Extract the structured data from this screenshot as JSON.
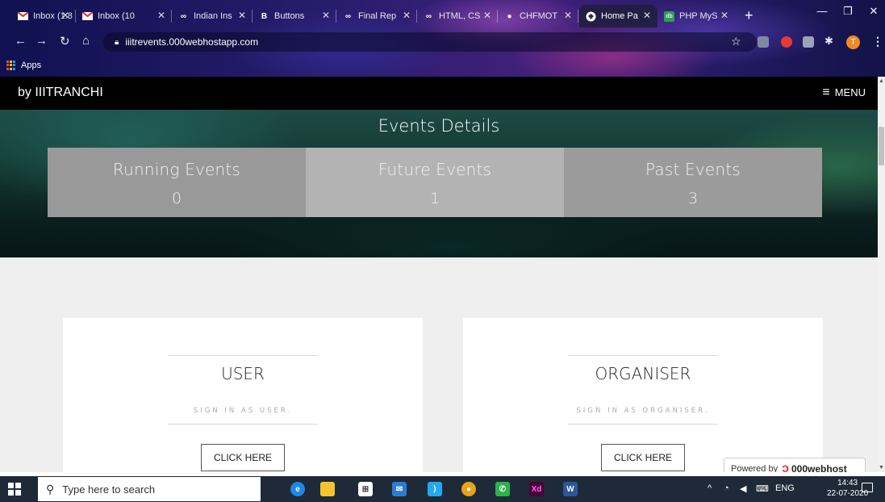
{
  "browser": {
    "tabs": [
      {
        "title": "Inbox (1.8",
        "icon": "gmail-icon",
        "active": false
      },
      {
        "title": "Inbox (10",
        "icon": "gmail-icon",
        "active": false
      },
      {
        "title": "Indian Ins",
        "icon": "infinity-icon",
        "active": false
      },
      {
        "title": "Buttons",
        "icon": "bootstrap-icon",
        "active": false
      },
      {
        "title": "Final Rep",
        "icon": "infinity-icon",
        "active": false
      },
      {
        "title": "HTML, CS",
        "icon": "infinity-icon",
        "active": false
      },
      {
        "title": "CHFMOT",
        "icon": "tab-icon",
        "active": false
      },
      {
        "title": "Home Pa",
        "icon": "globe-icon",
        "active": true
      },
      {
        "title": "PHP MyS",
        "icon": "phpmyadmin-icon",
        "active": false
      }
    ],
    "url": "iiitrevents.000webhostapp.com",
    "bookmarks_label": "Apps",
    "profile_initial": "T"
  },
  "site": {
    "brand": "by IIITRANCHI",
    "menu_label": "MENU",
    "hero_title": "Events Details",
    "stats": [
      {
        "label": "Running Events",
        "value": "0"
      },
      {
        "label": "Future Events",
        "value": "1"
      },
      {
        "label": "Past Events",
        "value": "3"
      }
    ],
    "cards": [
      {
        "title": "USER",
        "subtitle": "SIGN IN AS USER.",
        "button": "CLICK HERE"
      },
      {
        "title": "ORGANISER",
        "subtitle": "SIGN IN AS ORGANISER.",
        "button": "CLICK HERE"
      }
    ],
    "powered": {
      "prefix": "Powered by",
      "name": "000webhost"
    }
  },
  "taskbar": {
    "search_placeholder": "Type here to search",
    "language": "ENG",
    "time": "14:43",
    "date": "22-07-2020"
  },
  "colors": {
    "nav_bg": "#000000",
    "stat_running": "#999999",
    "stat_future": "#b3b3b3",
    "stat_past": "#9b9b9b",
    "content_bg": "#efefef",
    "taskbar_bg": "#1f2a38"
  }
}
